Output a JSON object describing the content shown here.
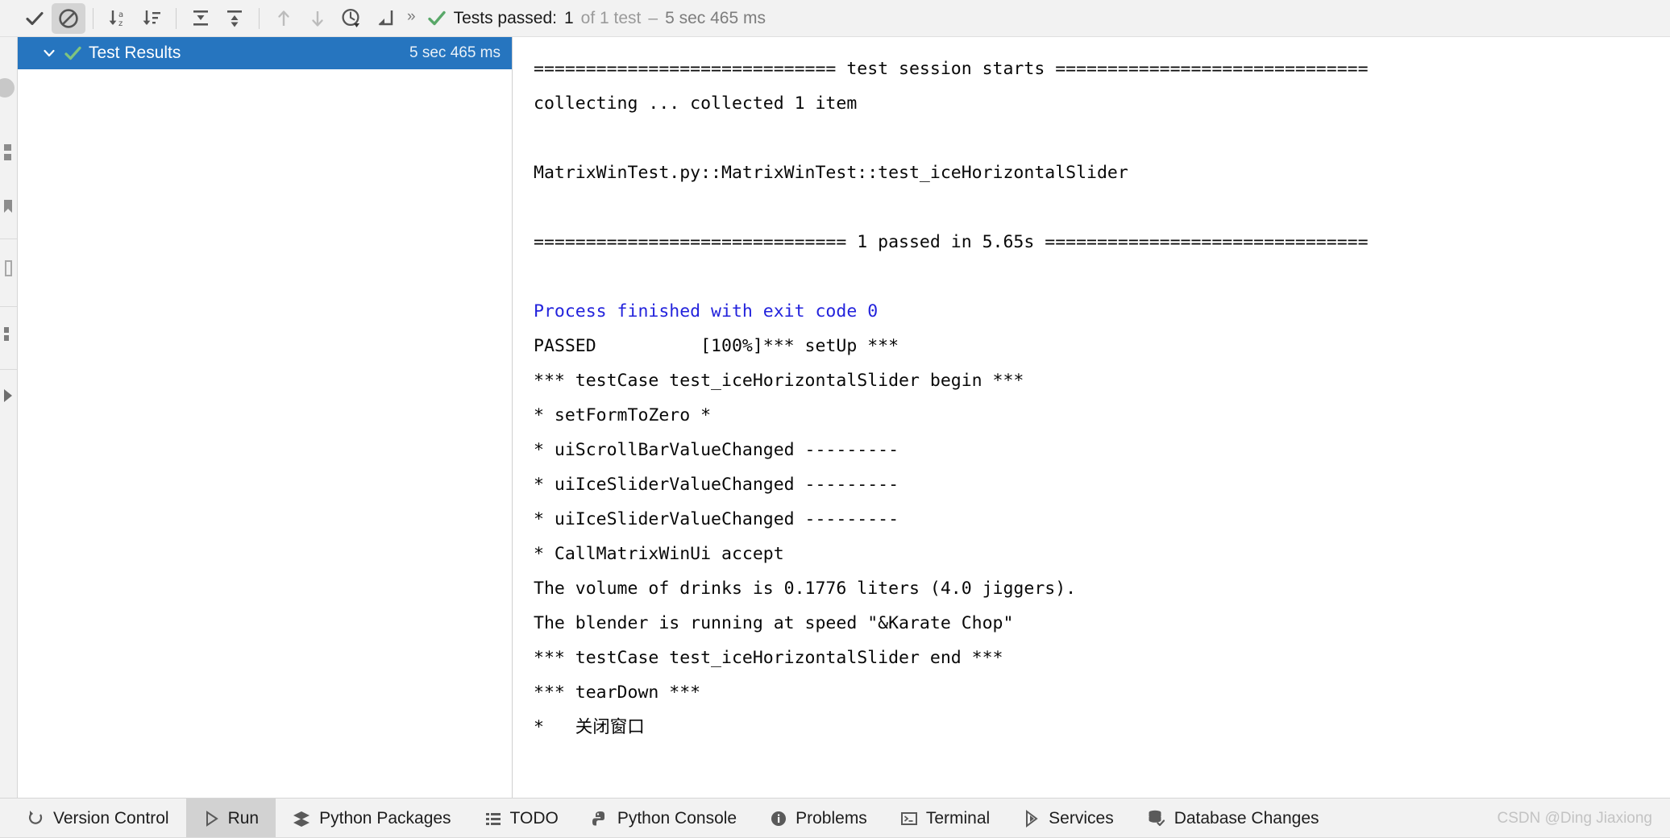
{
  "toolbar": {
    "buttons": [
      {
        "name": "show-passed-toggle",
        "icon": "check-icon",
        "pressed": false
      },
      {
        "name": "show-ignored-toggle",
        "icon": "no-entry-icon",
        "pressed": true
      },
      {
        "name": "sort-alphabetically-button",
        "icon": "sort-alpha-icon",
        "pressed": false
      },
      {
        "name": "sort-by-duration-button",
        "icon": "sort-duration-icon",
        "pressed": false
      },
      {
        "name": "expand-all-button",
        "icon": "expand-all-icon",
        "pressed": false
      },
      {
        "name": "collapse-all-button",
        "icon": "collapse-all-icon",
        "pressed": false
      },
      {
        "name": "previous-failed-test-button",
        "icon": "arrow-up-icon",
        "pressed": false
      },
      {
        "name": "next-failed-test-button",
        "icon": "arrow-down-icon",
        "pressed": false
      },
      {
        "name": "test-history-button",
        "icon": "clock-icon",
        "pressed": false
      },
      {
        "name": "scroll-to-source-button",
        "icon": "jump-to-source-icon",
        "pressed": false
      }
    ],
    "overflow_label": "»",
    "status": {
      "icon": "green-check-icon",
      "label": "Tests passed:",
      "count": "1",
      "of_text": "of 1 test",
      "separator": "–",
      "duration": "5 sec 465 ms"
    }
  },
  "left_strip": {
    "icons": [
      "avatar-icon",
      "structure-icon",
      "bookmarks-icon",
      "notifications-icon",
      "commit-icon",
      "run-arrow-icon"
    ]
  },
  "tree": {
    "row": {
      "expand_icon": "chevron-down-icon",
      "status_icon": "green-check-icon",
      "label": "Test Results",
      "duration": "5 sec 465 ms",
      "selected": true
    }
  },
  "console": {
    "lines": [
      {
        "text": "============================= test session starts ==============================",
        "style": "normal"
      },
      {
        "text": "collecting ... collected 1 item",
        "style": "normal"
      },
      {
        "text": "",
        "style": "blank"
      },
      {
        "text": "MatrixWinTest.py::MatrixWinTest::test_iceHorizontalSlider",
        "style": "normal"
      },
      {
        "text": "",
        "style": "blank"
      },
      {
        "text": "============================== 1 passed in 5.65s ===============================",
        "style": "normal"
      },
      {
        "text": "",
        "style": "blank"
      },
      {
        "text": "Process finished with exit code 0",
        "style": "blue"
      },
      {
        "text": "PASSED          [100%]*** setUp ***",
        "style": "normal"
      },
      {
        "text": "*** testCase test_iceHorizontalSlider begin ***",
        "style": "normal"
      },
      {
        "text": "* setFormToZero *",
        "style": "normal"
      },
      {
        "text": "* uiScrollBarValueChanged ---------",
        "style": "normal"
      },
      {
        "text": "* uiIceSliderValueChanged ---------",
        "style": "normal"
      },
      {
        "text": "* uiIceSliderValueChanged ---------",
        "style": "normal"
      },
      {
        "text": "* CallMatrixWinUi accept",
        "style": "normal"
      },
      {
        "text": "The volume of drinks is 0.1776 liters (4.0 jiggers).",
        "style": "normal"
      },
      {
        "text": "The blender is running at speed \"&Karate Chop\"",
        "style": "normal"
      },
      {
        "text": "*** testCase test_iceHorizontalSlider end ***",
        "style": "normal"
      },
      {
        "text": "*** tearDown ***",
        "style": "normal"
      },
      {
        "text": "*   关闭窗口",
        "style": "normal"
      }
    ]
  },
  "statusbar": {
    "items": [
      {
        "label": "Version Control",
        "icon": "version-control-icon",
        "active": false
      },
      {
        "label": "Run",
        "icon": "run-play-icon",
        "active": true
      },
      {
        "label": "Python Packages",
        "icon": "python-packages-icon",
        "active": false
      },
      {
        "label": "TODO",
        "icon": "todo-list-icon",
        "active": false
      },
      {
        "label": "Python Console",
        "icon": "python-console-icon",
        "active": false
      },
      {
        "label": "Problems",
        "icon": "problems-icon",
        "active": false
      },
      {
        "label": "Terminal",
        "icon": "terminal-icon",
        "active": false
      },
      {
        "label": "Services",
        "icon": "services-icon",
        "active": false
      },
      {
        "label": "Database Changes",
        "icon": "database-changes-icon",
        "active": false
      }
    ],
    "watermark": "CSDN @Ding Jiaxiong"
  },
  "colors": {
    "selection_blue": "#2675bf",
    "process_blue": "#2323dc",
    "success_green": "#59a869",
    "toolbar_bg": "#f2f2f2",
    "console_bg": "#ffffff"
  }
}
